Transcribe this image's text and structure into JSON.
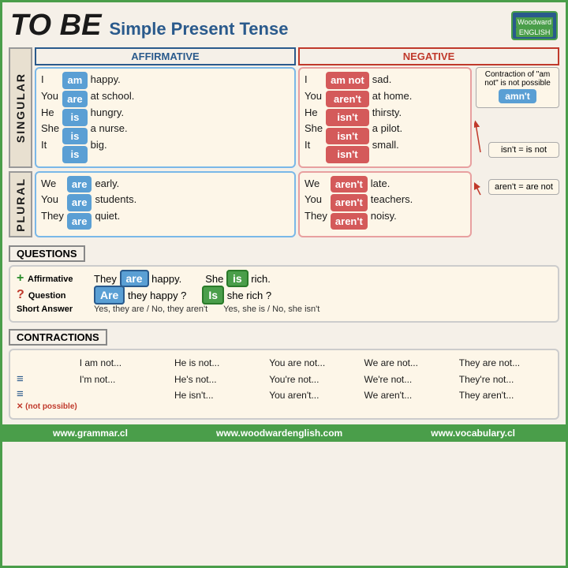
{
  "title": {
    "tobe": "TO BE",
    "subtitle": "Simple Present Tense"
  },
  "logo": {
    "brand": "Woodward",
    "sub": "ENGLISH"
  },
  "sections": {
    "affirmative_label": "AFFIRMATIVE",
    "negative_label": "NEGATIVE",
    "singular_label": "SINGULAR",
    "plural_label": "PLURAL",
    "questions_label": "QUESTIONS",
    "contractions_label": "CONTRACTIONS"
  },
  "singular": {
    "aff": {
      "pronouns": [
        "I",
        "You",
        "He",
        "She",
        "It"
      ],
      "verbs": [
        "am",
        "are",
        "is",
        "is",
        "is"
      ],
      "complements": [
        "happy.",
        "at school.",
        "hungry.",
        "a nurse.",
        "big."
      ]
    },
    "neg": {
      "pronouns": [
        "I",
        "You",
        "He",
        "She",
        "It"
      ],
      "verbs": [
        "am not",
        "aren't",
        "isn't",
        "isn't",
        "isn't"
      ],
      "complements": [
        "sad.",
        "at home.",
        "thirsty.",
        "a pilot.",
        "small."
      ]
    }
  },
  "plural": {
    "aff": {
      "pronouns": [
        "We",
        "You",
        "They"
      ],
      "verbs": [
        "are",
        "are",
        "are"
      ],
      "complements": [
        "early.",
        "students.",
        "quiet."
      ]
    },
    "neg": {
      "pronouns": [
        "We",
        "You",
        "They"
      ],
      "verbs": [
        "aren't",
        "aren't",
        "aren't"
      ],
      "complements": [
        "late.",
        "teachers.",
        "noisy."
      ]
    }
  },
  "callouts": {
    "contraction_note": "Contraction of \"am not\" is not possible",
    "amnt": "amn't",
    "isnt_eq": "isn't = is not",
    "arent_eq": "aren't = are not"
  },
  "questions": {
    "affirmative_label": "+ Affirmative",
    "question_label": "? Question",
    "short_answer_label": "Short Answer",
    "aff1": "They",
    "verb1": "are",
    "aff1_rest": "happy.",
    "aff2": "She",
    "verb2": "is",
    "aff2_rest": "rich.",
    "q1_verb": "Are",
    "q1_rest": "they happy ?",
    "q2_verb": "Is",
    "q2_rest": "she rich ?",
    "sa1": "Yes, they are / No, they aren't",
    "sa2": "Yes, she is / No, she isn't"
  },
  "contractions": {
    "columns": [
      {
        "line1": "I am not...",
        "line2": "I'm not...",
        "line3": "✕ (not possible)"
      },
      {
        "line1": "He is not...",
        "line2": "He's not...",
        "line3": "He isn't..."
      },
      {
        "line1": "You are not...",
        "line2": "You're not...",
        "line3": "You aren't..."
      },
      {
        "line1": "We are not...",
        "line2": "We're not...",
        "line3": "We aren't..."
      },
      {
        "line1": "They are not...",
        "line2": "They're not...",
        "line3": "They aren't..."
      }
    ]
  },
  "footer": {
    "link1": "www.grammar.cl",
    "link2": "www.woodwardenglish.com",
    "link3": "www.vocabulary.cl"
  }
}
